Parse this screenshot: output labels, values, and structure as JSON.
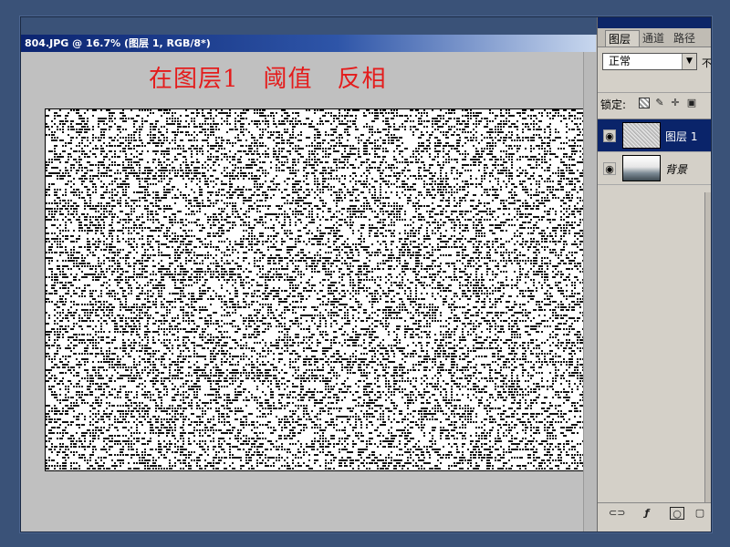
{
  "document": {
    "title": "804.JPG @ 16.7% (图层 1, RGB/8*)"
  },
  "annotation": {
    "text": "在图层1　阈值　反相",
    "color": "#e41c1c"
  },
  "layers_panel": {
    "tabs": [
      {
        "label": "图层"
      },
      {
        "label": "通道"
      },
      {
        "label": "路径"
      }
    ],
    "blend_mode": "正常",
    "opacity_stub": "不",
    "lock_label": "锁定:",
    "layers": [
      {
        "name": "图层 1",
        "selected": true
      },
      {
        "name": "背景",
        "selected": false
      }
    ]
  },
  "colors": {
    "desktop": "#3a5278",
    "titlebar_start": "#0b2470",
    "selection": "#0a246a",
    "workspace": "#c0c0c0"
  }
}
